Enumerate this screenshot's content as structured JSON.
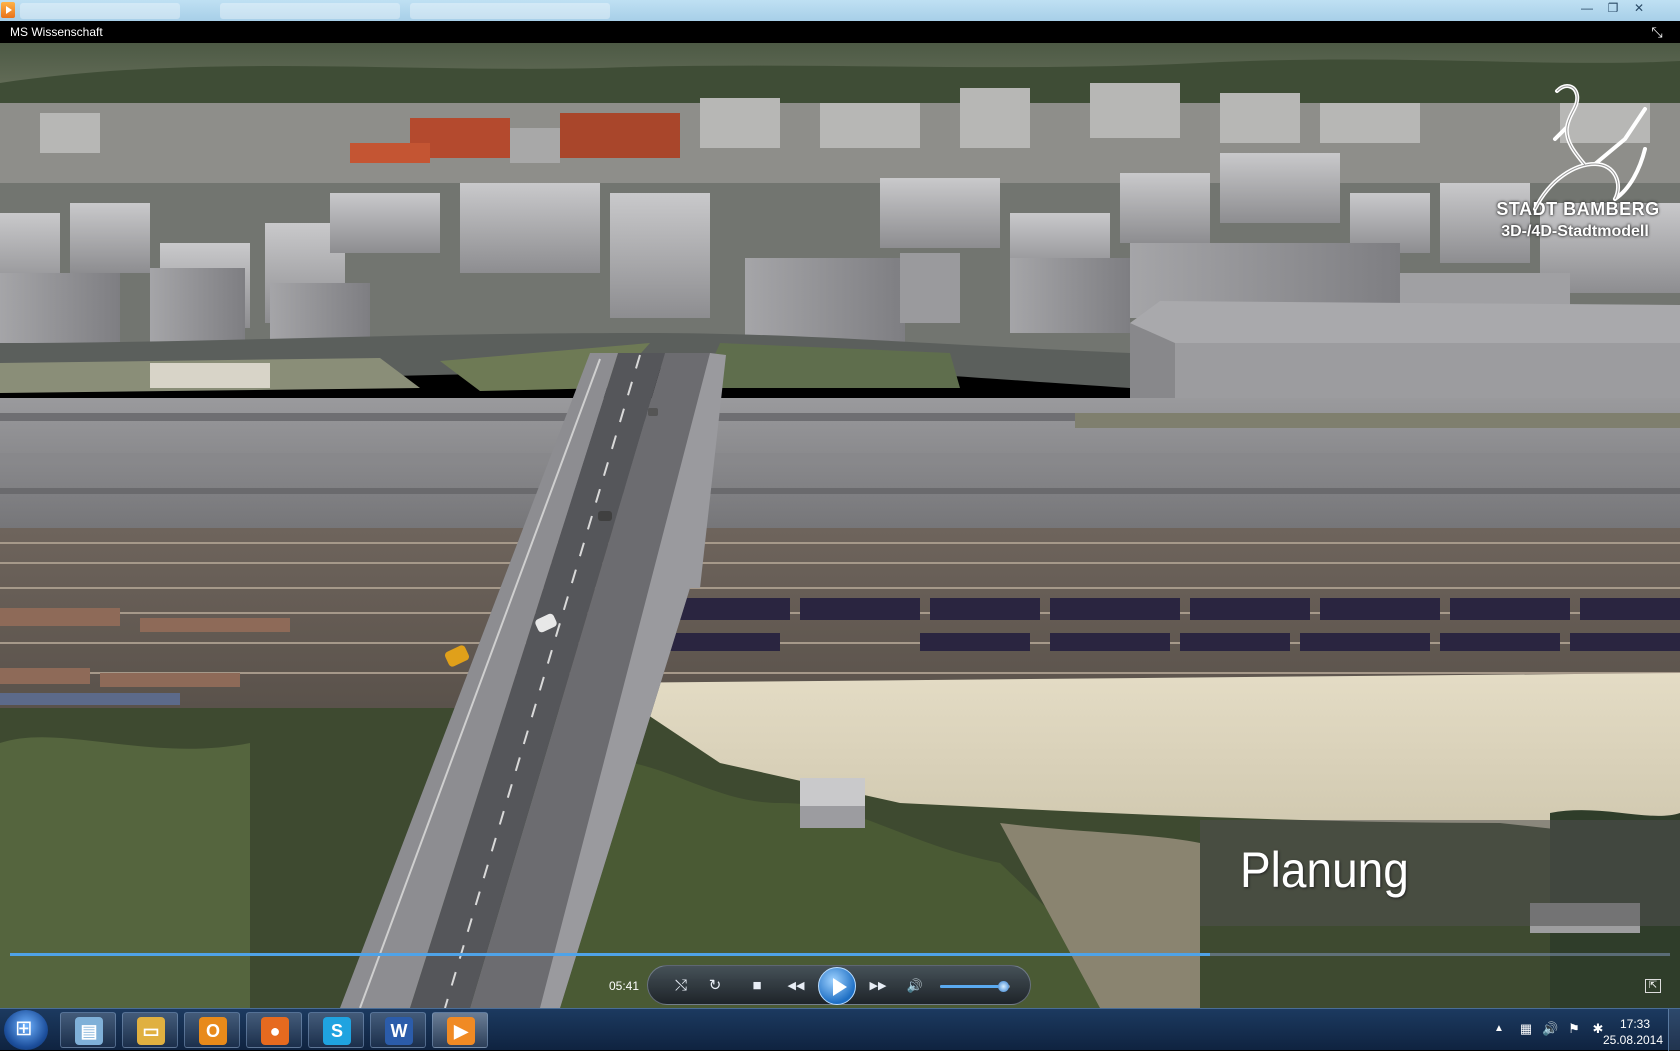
{
  "window": {
    "title": "MS Wissenschaft",
    "controls": {
      "minimize": "—",
      "maximize": "❐",
      "close": "✕"
    }
  },
  "watermark": {
    "line1": "STADT BAMBERG",
    "line2": "3D-/4D-Stadtmodell"
  },
  "caption": "Planung",
  "player": {
    "time": "05:41",
    "progress_percent": 72.3,
    "volume_percent": 90,
    "icons": {
      "shuffle": "shuffle-icon",
      "repeat": "repeat-icon",
      "stop": "stop-icon",
      "previous": "previous-icon",
      "play": "play-icon",
      "next": "next-icon",
      "mute": "speaker-icon",
      "switch": "switch-to-library-icon",
      "fullscreen": "collapse-icon"
    },
    "glyphs": {
      "shuffle": "⤭",
      "repeat": "↻",
      "stop": "■",
      "previous": "◀◀",
      "next": "▶▶",
      "mute": "🔊",
      "switch": "⇱",
      "fullscreen": "⤡"
    }
  },
  "taskbar": {
    "apps": [
      {
        "name": "explorer-shell",
        "icon": "book-icon",
        "glyph": "▤",
        "color": "#7fb0d8"
      },
      {
        "name": "file-explorer",
        "icon": "folder-icon",
        "glyph": "▭",
        "color": "#e0b040"
      },
      {
        "name": "outlook",
        "icon": "outlook-icon",
        "glyph": "O",
        "color": "#e88a1a"
      },
      {
        "name": "firefox",
        "icon": "firefox-icon",
        "glyph": "●",
        "color": "#e66a1f"
      },
      {
        "name": "skype",
        "icon": "skype-icon",
        "glyph": "S",
        "color": "#1fa3e0"
      },
      {
        "name": "word",
        "icon": "word-icon",
        "glyph": "W",
        "color": "#2b5caa"
      },
      {
        "name": "media-player",
        "icon": "media-player-icon",
        "glyph": "▶",
        "color": "#f08a24"
      }
    ],
    "tray": {
      "arrow": "▲",
      "network": "▦",
      "volume": "🔊",
      "flag": "⚑",
      "bluetooth": "✱"
    },
    "clock": {
      "time": "17:33",
      "date": "25.08.2014"
    }
  }
}
